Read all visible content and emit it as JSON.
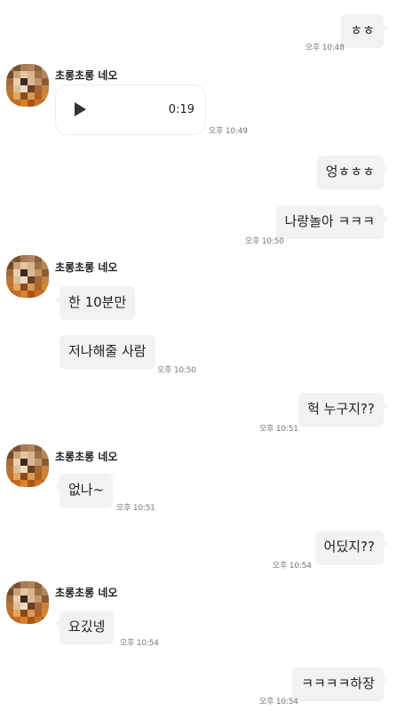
{
  "contact_name": "초롱초롱 네오",
  "voice": {
    "duration": "0:19"
  },
  "messages": [
    {
      "text": "ㅎㅎ",
      "time": "오후 10:48"
    },
    {
      "time": "오후 10:49"
    },
    {
      "text": "엉ㅎㅎㅎ"
    },
    {
      "text": "나랑놀아 ㅋㅋㅋ",
      "time": "오후 10:50"
    },
    {
      "text": "한 10분만"
    },
    {
      "text": "저나해줄 사람",
      "time": "오후 10:50"
    },
    {
      "text": "헉 누구지??",
      "time": "오후 10:51"
    },
    {
      "text": "없나~",
      "time": "오후 10:51"
    },
    {
      "text": "어딨지??",
      "time": "오후 10:54"
    },
    {
      "text": "요깄넹",
      "time": "오후 10:54"
    },
    {
      "text": "ㅋㅋㅋㅋ하장",
      "time": "오후 10:54"
    }
  ],
  "colors": {
    "bubble": "#f2f2f2",
    "background": "#ffffff"
  }
}
